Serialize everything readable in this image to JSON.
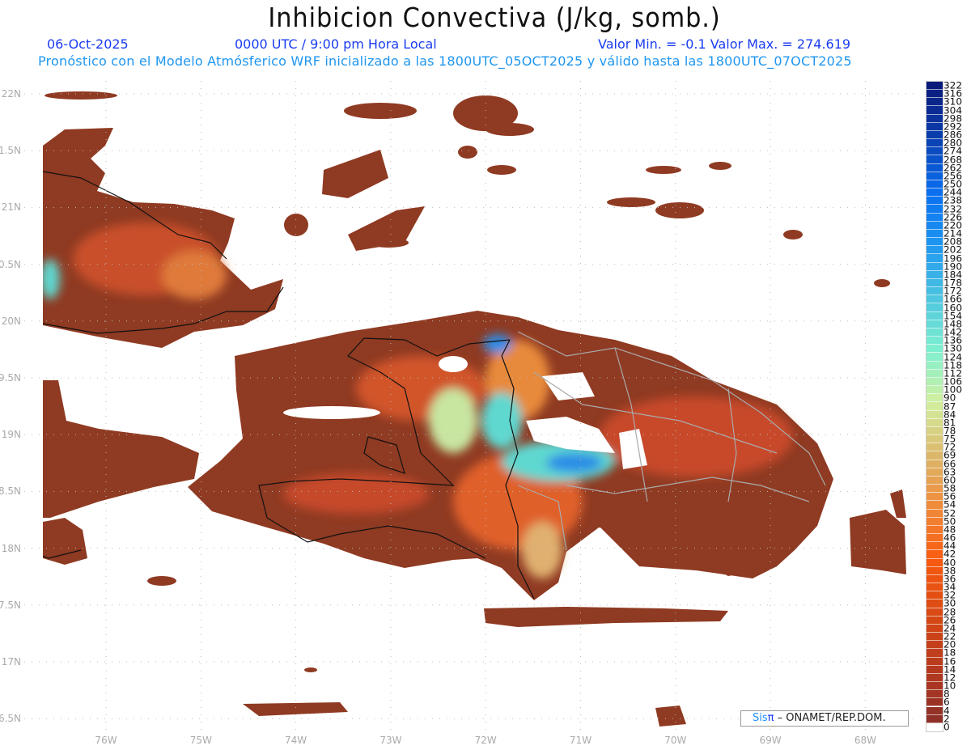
{
  "header": {
    "title": "Inhibicion Convectiva (J/kg, somb.)",
    "date": "06-Oct-2025",
    "time": "0000 UTC / 9:00 pm Hora Local",
    "min_max": "Valor Min. = -0.1  Valor Max. = 274.619",
    "subtitle": "Pronóstico con el Modelo Atmósferico WRF inicializado a las 1800UTC_05OCT2025 y válido hasta las  1800UTC_07OCT2025"
  },
  "axes": {
    "lat_labels": [
      "22N",
      "1.5N",
      "21N",
      "0.5N",
      "20N",
      "9.5N",
      "19N",
      "8.5N",
      "18N",
      "7.5N",
      "17N",
      "6.5N"
    ],
    "lon_labels": [
      "76W",
      "75W",
      "74W",
      "73W",
      "72W",
      "71W",
      "70W",
      "69W",
      "68W"
    ]
  },
  "colorbar": {
    "labels": [
      "322",
      "316",
      "310",
      "304",
      "298",
      "292",
      "286",
      "280",
      "274",
      "268",
      "262",
      "256",
      "250",
      "244",
      "238",
      "232",
      "226",
      "220",
      "214",
      "208",
      "202",
      "196",
      "190",
      "184",
      "178",
      "172",
      "166",
      "160",
      "154",
      "148",
      "142",
      "136",
      "130",
      "124",
      "118",
      "112",
      "106",
      "100",
      "90",
      "87",
      "84",
      "81",
      "78",
      "75",
      "72",
      "69",
      "66",
      "63",
      "60",
      "58",
      "56",
      "54",
      "52",
      "50",
      "48",
      "46",
      "44",
      "42",
      "40",
      "38",
      "36",
      "34",
      "32",
      "30",
      "28",
      "26",
      "24",
      "22",
      "20",
      "18",
      "16",
      "14",
      "12",
      "10",
      "8",
      "6",
      "4",
      "2",
      "0"
    ],
    "palette_stops": [
      "#0a1a7a",
      "#0a3fb0",
      "#0a6ef0",
      "#1e96f0",
      "#4cc4e0",
      "#7ef0d0",
      "#d2f0a0",
      "#dcb86a",
      "#f08a3a",
      "#f85a10",
      "#d84a14",
      "#b83a1e",
      "#8e3028",
      "#ffffff"
    ]
  },
  "credit": {
    "sis": "Sis",
    "pi": "π",
    "org": "– ONAMET/REP.DOM."
  },
  "colors": {
    "land_base": "#8f3a22",
    "hot": "#df5a22",
    "warm": "#e88a3a",
    "cyan": "#5fd8d0",
    "green": "#c8e6a0",
    "blue": "#2a8ce6"
  }
}
